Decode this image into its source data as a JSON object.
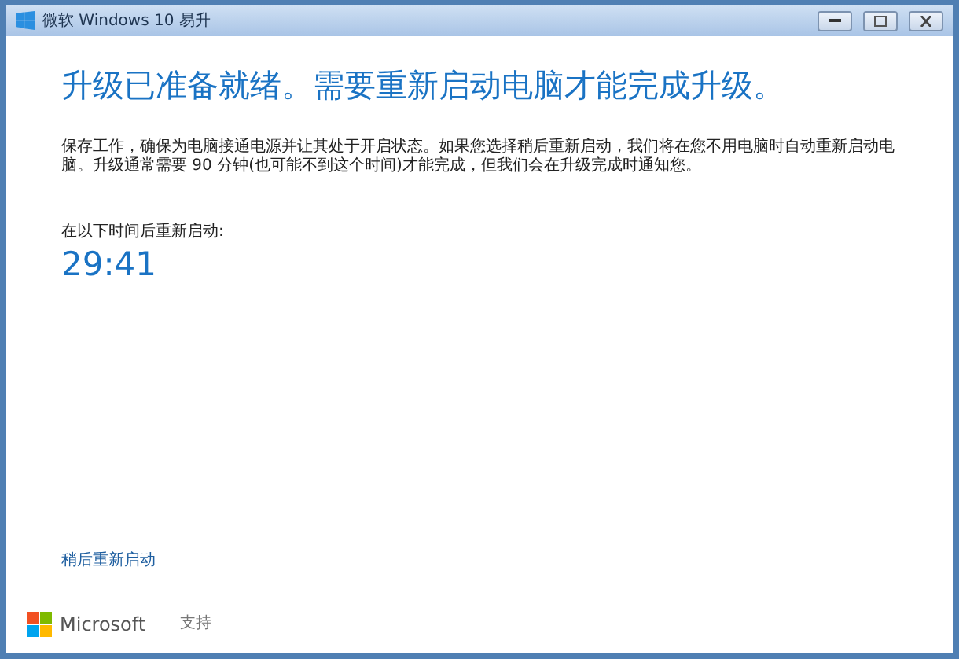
{
  "window": {
    "title": "微软 Windows 10 易升"
  },
  "heading": "升级已准备就绪。需要重新启动电脑才能完成升级。",
  "description": "保存工作，确保为电脑接通电源并让其处于开启状态。如果您选择稍后重新启动，我们将在您不用电脑时自动重新启动电脑。升级通常需要 90 分钟(也可能不到这个时间)才能完成，但我们会在升级完成时通知您。",
  "countdown": {
    "label": "在以下时间后重新启动:",
    "time": "29:41"
  },
  "restart_later_link": "稍后重新启动",
  "footer": {
    "brand": "Microsoft",
    "support_link": "支持"
  }
}
